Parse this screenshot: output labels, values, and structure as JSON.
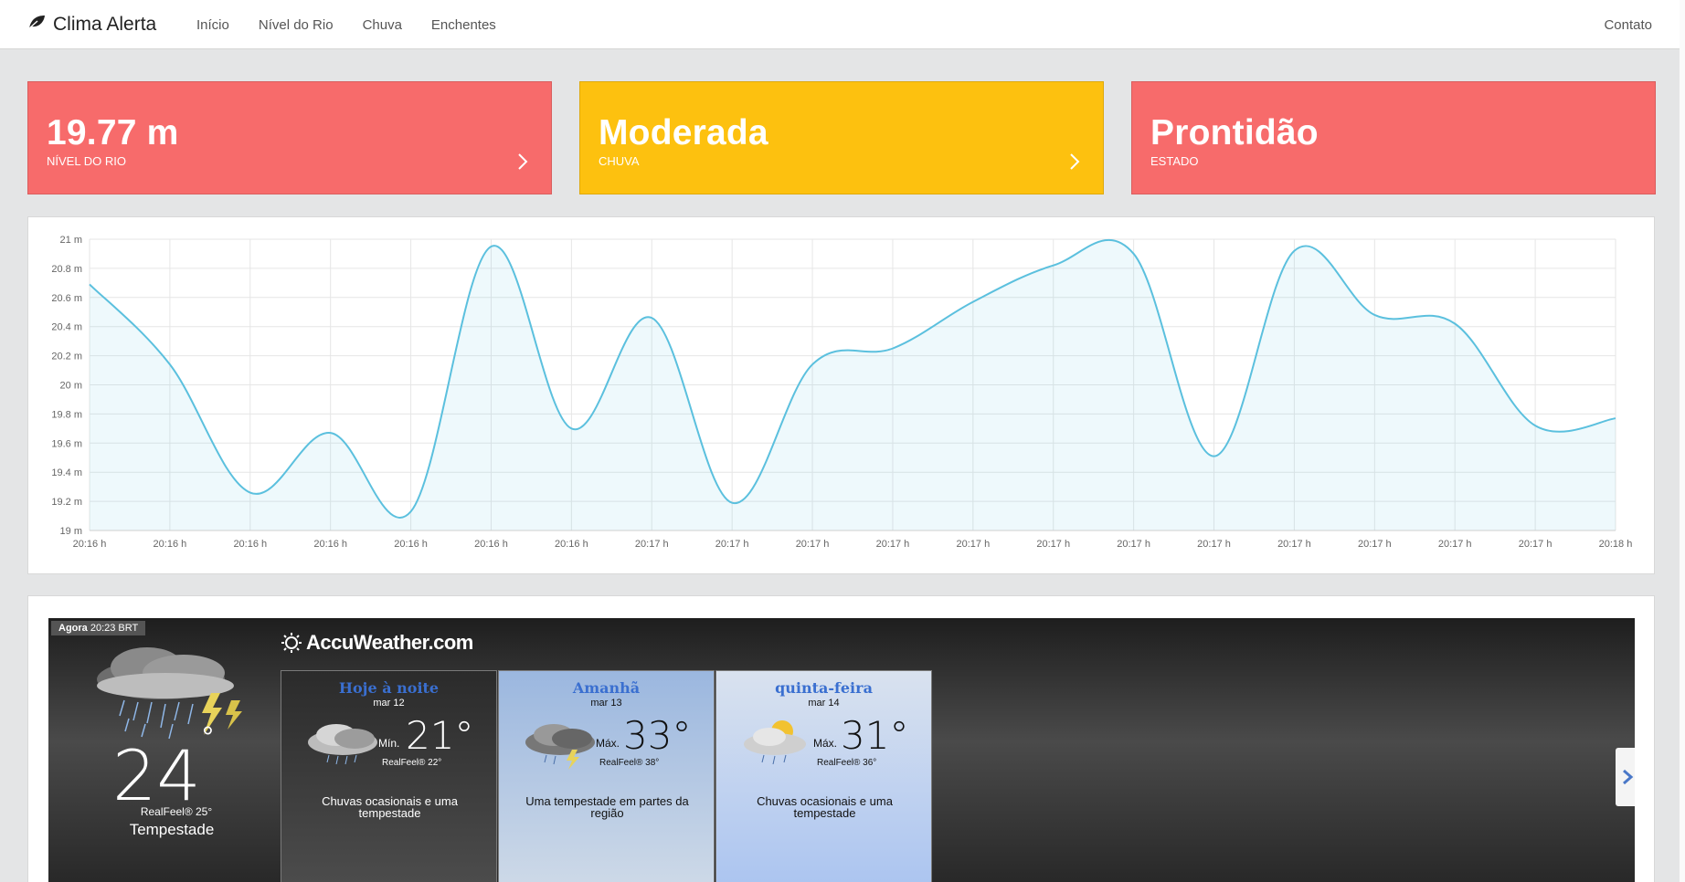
{
  "navbar": {
    "brand": "Clima Alerta",
    "brand_icon": "leaf-icon",
    "links": [
      "Início",
      "Nível do Rio",
      "Chuva",
      "Enchentes"
    ],
    "right_link": "Contato"
  },
  "cards": [
    {
      "value": "19.77 m",
      "label": "Nível do Rio",
      "color": "#f76b6b",
      "has_arrow": true
    },
    {
      "value": "Moderada",
      "label": "Chuva",
      "color": "#fdc10f",
      "has_arrow": true
    },
    {
      "value": "Prontidão",
      "label": "Estado",
      "color": "#f76b6b",
      "has_arrow": false
    }
  ],
  "chart_data": {
    "type": "area",
    "x": [
      "20:16 h",
      "20:16 h",
      "20:16 h",
      "20:16 h",
      "20:16 h",
      "20:16 h",
      "20:16 h",
      "20:17 h",
      "20:17 h",
      "20:17 h",
      "20:17 h",
      "20:17 h",
      "20:17 h",
      "20:17 h",
      "20:17 h",
      "20:17 h",
      "20:17 h",
      "20:17 h",
      "20:17 h",
      "20:18 h"
    ],
    "series": [
      {
        "values": [
          20.69,
          20.14,
          19.26,
          19.67,
          19.13,
          20.95,
          19.7,
          20.46,
          19.19,
          20.14,
          20.25,
          20.57,
          20.82,
          20.9,
          19.51,
          20.92,
          20.48,
          20.42,
          19.72,
          19.77
        ]
      }
    ],
    "ylim": [
      19,
      21
    ],
    "yticks": [
      "19 m",
      "19.2 m",
      "19.4 m",
      "19.6 m",
      "19.8 m",
      "20 m",
      "20.2 m",
      "20.4 m",
      "20.6 m",
      "20.8 m",
      "21 m"
    ],
    "line_color": "#5bc0de",
    "fill_color": "rgba(91,192,222,0.10)",
    "grid": true
  },
  "weather": {
    "now_label": "Agora",
    "now_time": "20:23 BRT",
    "now_temp": "24",
    "now_deg": "°",
    "now_realfeel": "RealFeel® 25°",
    "now_condition": "Tempestade",
    "logo": "AccuWeather.com",
    "forecast": [
      {
        "day": "Hoje à noite",
        "date": "mar 12",
        "minmax": "Mín.",
        "temp": "21°",
        "realfeel": "RealFeel® 22°",
        "desc": "Chuvas ocasionais e uma tempestade"
      },
      {
        "day": "Amanhã",
        "date": "mar 13",
        "minmax": "Máx.",
        "temp": "33°",
        "realfeel": "RealFeel® 38°",
        "desc": "Uma tempestade em partes da região"
      },
      {
        "day": "quinta-feira",
        "date": "mar 14",
        "minmax": "Máx.",
        "temp": "31°",
        "realfeel": "RealFeel® 36°",
        "desc": "Chuvas ocasionais e uma tempestade"
      }
    ]
  }
}
